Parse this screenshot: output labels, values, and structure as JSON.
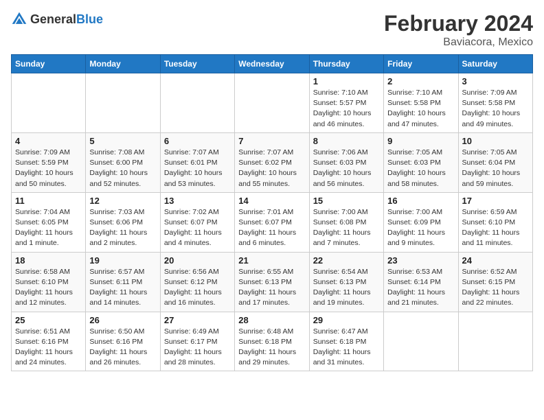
{
  "header": {
    "logo_general": "General",
    "logo_blue": "Blue",
    "month_year": "February 2024",
    "location": "Baviacora, Mexico"
  },
  "days_of_week": [
    "Sunday",
    "Monday",
    "Tuesday",
    "Wednesday",
    "Thursday",
    "Friday",
    "Saturday"
  ],
  "weeks": [
    [
      {
        "date": "",
        "info": ""
      },
      {
        "date": "",
        "info": ""
      },
      {
        "date": "",
        "info": ""
      },
      {
        "date": "",
        "info": ""
      },
      {
        "date": "1",
        "info": "Sunrise: 7:10 AM\nSunset: 5:57 PM\nDaylight: 10 hours\nand 46 minutes."
      },
      {
        "date": "2",
        "info": "Sunrise: 7:10 AM\nSunset: 5:58 PM\nDaylight: 10 hours\nand 47 minutes."
      },
      {
        "date": "3",
        "info": "Sunrise: 7:09 AM\nSunset: 5:58 PM\nDaylight: 10 hours\nand 49 minutes."
      }
    ],
    [
      {
        "date": "4",
        "info": "Sunrise: 7:09 AM\nSunset: 5:59 PM\nDaylight: 10 hours\nand 50 minutes."
      },
      {
        "date": "5",
        "info": "Sunrise: 7:08 AM\nSunset: 6:00 PM\nDaylight: 10 hours\nand 52 minutes."
      },
      {
        "date": "6",
        "info": "Sunrise: 7:07 AM\nSunset: 6:01 PM\nDaylight: 10 hours\nand 53 minutes."
      },
      {
        "date": "7",
        "info": "Sunrise: 7:07 AM\nSunset: 6:02 PM\nDaylight: 10 hours\nand 55 minutes."
      },
      {
        "date": "8",
        "info": "Sunrise: 7:06 AM\nSunset: 6:03 PM\nDaylight: 10 hours\nand 56 minutes."
      },
      {
        "date": "9",
        "info": "Sunrise: 7:05 AM\nSunset: 6:03 PM\nDaylight: 10 hours\nand 58 minutes."
      },
      {
        "date": "10",
        "info": "Sunrise: 7:05 AM\nSunset: 6:04 PM\nDaylight: 10 hours\nand 59 minutes."
      }
    ],
    [
      {
        "date": "11",
        "info": "Sunrise: 7:04 AM\nSunset: 6:05 PM\nDaylight: 11 hours\nand 1 minute."
      },
      {
        "date": "12",
        "info": "Sunrise: 7:03 AM\nSunset: 6:06 PM\nDaylight: 11 hours\nand 2 minutes."
      },
      {
        "date": "13",
        "info": "Sunrise: 7:02 AM\nSunset: 6:07 PM\nDaylight: 11 hours\nand 4 minutes."
      },
      {
        "date": "14",
        "info": "Sunrise: 7:01 AM\nSunset: 6:07 PM\nDaylight: 11 hours\nand 6 minutes."
      },
      {
        "date": "15",
        "info": "Sunrise: 7:00 AM\nSunset: 6:08 PM\nDaylight: 11 hours\nand 7 minutes."
      },
      {
        "date": "16",
        "info": "Sunrise: 7:00 AM\nSunset: 6:09 PM\nDaylight: 11 hours\nand 9 minutes."
      },
      {
        "date": "17",
        "info": "Sunrise: 6:59 AM\nSunset: 6:10 PM\nDaylight: 11 hours\nand 11 minutes."
      }
    ],
    [
      {
        "date": "18",
        "info": "Sunrise: 6:58 AM\nSunset: 6:10 PM\nDaylight: 11 hours\nand 12 minutes."
      },
      {
        "date": "19",
        "info": "Sunrise: 6:57 AM\nSunset: 6:11 PM\nDaylight: 11 hours\nand 14 minutes."
      },
      {
        "date": "20",
        "info": "Sunrise: 6:56 AM\nSunset: 6:12 PM\nDaylight: 11 hours\nand 16 minutes."
      },
      {
        "date": "21",
        "info": "Sunrise: 6:55 AM\nSunset: 6:13 PM\nDaylight: 11 hours\nand 17 minutes."
      },
      {
        "date": "22",
        "info": "Sunrise: 6:54 AM\nSunset: 6:13 PM\nDaylight: 11 hours\nand 19 minutes."
      },
      {
        "date": "23",
        "info": "Sunrise: 6:53 AM\nSunset: 6:14 PM\nDaylight: 11 hours\nand 21 minutes."
      },
      {
        "date": "24",
        "info": "Sunrise: 6:52 AM\nSunset: 6:15 PM\nDaylight: 11 hours\nand 22 minutes."
      }
    ],
    [
      {
        "date": "25",
        "info": "Sunrise: 6:51 AM\nSunset: 6:16 PM\nDaylight: 11 hours\nand 24 minutes."
      },
      {
        "date": "26",
        "info": "Sunrise: 6:50 AM\nSunset: 6:16 PM\nDaylight: 11 hours\nand 26 minutes."
      },
      {
        "date": "27",
        "info": "Sunrise: 6:49 AM\nSunset: 6:17 PM\nDaylight: 11 hours\nand 28 minutes."
      },
      {
        "date": "28",
        "info": "Sunrise: 6:48 AM\nSunset: 6:18 PM\nDaylight: 11 hours\nand 29 minutes."
      },
      {
        "date": "29",
        "info": "Sunrise: 6:47 AM\nSunset: 6:18 PM\nDaylight: 11 hours\nand 31 minutes."
      },
      {
        "date": "",
        "info": ""
      },
      {
        "date": "",
        "info": ""
      }
    ]
  ]
}
